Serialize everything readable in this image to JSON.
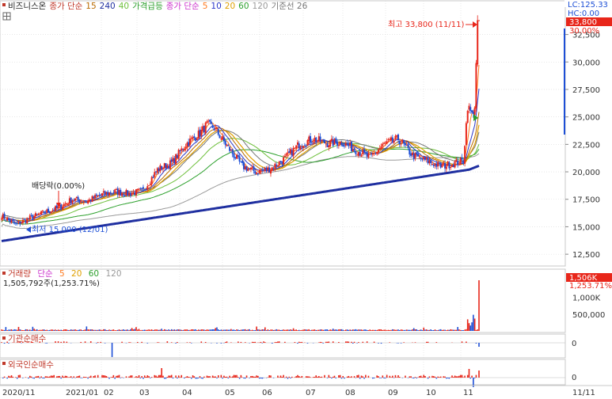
{
  "colors": {
    "up": "#e8261a",
    "down": "#1d4fd6",
    "ma5": "#ff7a1f",
    "ma10": "#2a36c9",
    "ma20": "#e0a000",
    "ma60": "#2ca02c",
    "ma120": "#9a9a9a",
    "ma240": "#1f2fa0",
    "ma15": "#b96a00",
    "ma40": "#6dbf3a",
    "kijun": "#777777",
    "grid": "#d9d9d9",
    "axis": "#555555"
  },
  "price_legend": [
    {
      "text": "비즈니스온",
      "color": "#222222"
    },
    {
      "text": "종가 단순",
      "color": "#c0392b"
    },
    {
      "text": "15",
      "color": "#b96a00"
    },
    {
      "text": "240",
      "color": "#1f2fa0"
    },
    {
      "text": "40",
      "color": "#6dbf3a"
    },
    {
      "text": "가격급등",
      "color": "#2ca02c"
    },
    {
      "text": "종가 단순",
      "color": "#cc33cc"
    },
    {
      "text": "5",
      "color": "#ff7a1f"
    },
    {
      "text": "10",
      "color": "#2a36c9"
    },
    {
      "text": "20",
      "color": "#e0a000"
    },
    {
      "text": "60",
      "color": "#2ca02c"
    },
    {
      "text": "120",
      "color": "#9a9a9a"
    },
    {
      "text": "기준선 26",
      "color": "#777777"
    }
  ],
  "corner_info": {
    "lc": "LC:125.33",
    "hc": "HC:0.00",
    "last_price": "33,800",
    "last_pct": "30.00%",
    "vol_last": "1,506K",
    "vol_pct": "1,253.71%"
  },
  "annotations": {
    "high_label": "최고 33,800 (11/11)",
    "low_label": "최저 15,000 (12/01)",
    "dividend_label": "배당락(0.00%)",
    "volume_legend_title": "거래량",
    "volume_legend_simple": "단순",
    "volume_legend_5": "5",
    "volume_legend_20": "20",
    "volume_legend_60": "60",
    "volume_legend_120": "120",
    "volume_info": "1,505,792주(1,253.71%)",
    "inst_title": "기관순매수",
    "foreign_title": "외국인순매수",
    "inst_zero": "0",
    "foreign_zero": "0"
  },
  "chart_data": {
    "type": "candlestick",
    "title": "비즈니스온",
    "ylim": [
      11500,
      34200
    ],
    "y_ticks": [
      "32,500",
      "30,000",
      "27,500",
      "25,000",
      "22,500",
      "20,000",
      "17,500",
      "15,000",
      "12,500"
    ],
    "y_tick_values": [
      32500,
      30000,
      27500,
      25000,
      22500,
      20000,
      17500,
      15000,
      12500
    ],
    "x_ticks": [
      "2020/11",
      "2021/01",
      "02",
      "03",
      "04",
      "05",
      "06",
      "07",
      "08",
      "09",
      "10",
      "11",
      "11/11"
    ],
    "high": 33800,
    "low": 15000,
    "close_trend": [
      [
        0,
        16000
      ],
      [
        10,
        15200
      ],
      [
        20,
        15800
      ],
      [
        30,
        16300
      ],
      [
        40,
        16700
      ],
      [
        50,
        17500
      ],
      [
        60,
        17300
      ],
      [
        70,
        17900
      ],
      [
        80,
        18200
      ],
      [
        90,
        18000
      ],
      [
        100,
        18300
      ],
      [
        110,
        20200
      ],
      [
        120,
        20800
      ],
      [
        130,
        22500
      ],
      [
        140,
        23500
      ],
      [
        145,
        24300
      ],
      [
        150,
        24000
      ],
      [
        160,
        22200
      ],
      [
        170,
        20500
      ],
      [
        180,
        20000
      ],
      [
        190,
        20300
      ],
      [
        200,
        21200
      ],
      [
        210,
        22500
      ],
      [
        220,
        23000
      ],
      [
        230,
        22600
      ],
      [
        240,
        22700
      ],
      [
        250,
        22000
      ],
      [
        260,
        21300
      ],
      [
        270,
        22500
      ],
      [
        280,
        23000
      ],
      [
        290,
        21500
      ],
      [
        300,
        21000
      ],
      [
        310,
        20500
      ],
      [
        320,
        20800
      ],
      [
        326,
        21000
      ],
      [
        329,
        26000
      ],
      [
        332,
        25200
      ],
      [
        334,
        26000
      ],
      [
        336,
        33800
      ]
    ],
    "volume_ylim": [
      0,
      1600000
    ],
    "volume_ticks": [
      "1,000K",
      "500,000"
    ],
    "volume_tick_values": [
      1000000,
      500000
    ],
    "volume_last": 1505792,
    "institution_net": "sparse, small values; large spike at 2021/02",
    "foreign_net": "daily small values; spike near 05 and at 11"
  }
}
